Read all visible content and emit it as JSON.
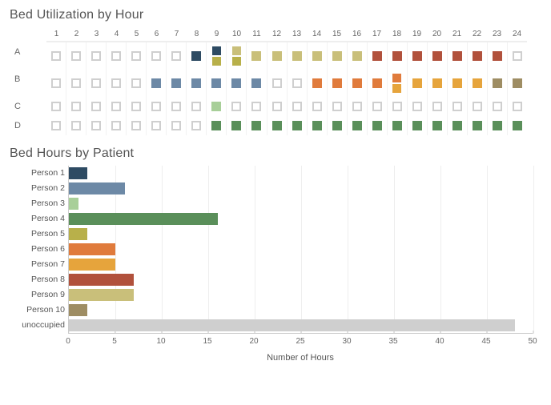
{
  "titles": {
    "heatmap": "Bed Utilization by Hour",
    "bars": "Bed Hours by Patient",
    "xlabel": "Number of Hours"
  },
  "colors": {
    "Person 1": "#2e4b63",
    "Person 2": "#6d89a6",
    "Person 3": "#a8cf99",
    "Person 4": "#5a8f5a",
    "Person 5": "#b8b04a",
    "Person 6": "#e07b3c",
    "Person 7": "#e6a43c",
    "Person 8": "#b1513c",
    "Person 9": "#c9bf7a",
    "Person 10": "#9e8d63",
    "unoccupied": "#cfcfcf"
  },
  "chart_data": [
    {
      "type": "heatmap",
      "title": "Bed Utilization by Hour",
      "x": [
        1,
        2,
        3,
        4,
        5,
        6,
        7,
        8,
        9,
        10,
        11,
        12,
        13,
        14,
        15,
        16,
        17,
        18,
        19,
        20,
        21,
        22,
        23,
        24
      ],
      "beds": [
        "A",
        "B",
        "C",
        "D"
      ],
      "occupancy": {
        "A": [
          "unoccupied",
          "unoccupied",
          "unoccupied",
          "unoccupied",
          "unoccupied",
          "unoccupied",
          "unoccupied",
          "Person 1",
          [
            "Person 1",
            "Person 5"
          ],
          [
            "Person 9",
            "Person 5"
          ],
          "Person 9",
          "Person 9",
          "Person 9",
          "Person 9",
          "Person 9",
          "Person 9",
          "Person 8",
          "Person 8",
          "Person 8",
          "Person 8",
          "Person 8",
          "Person 8",
          "Person 8",
          "unoccupied"
        ],
        "B": [
          "unoccupied",
          "unoccupied",
          "unoccupied",
          "unoccupied",
          "unoccupied",
          "Person 2",
          "Person 2",
          "Person 2",
          "Person 2",
          "Person 2",
          "Person 2",
          "unoccupied",
          "unoccupied",
          "Person 6",
          "Person 6",
          "Person 6",
          "Person 6",
          [
            "Person 6",
            "Person 7"
          ],
          "Person 7",
          "Person 7",
          "Person 7",
          "Person 7",
          "Person 10",
          "Person 10"
        ],
        "C": [
          "unoccupied",
          "unoccupied",
          "unoccupied",
          "unoccupied",
          "unoccupied",
          "unoccupied",
          "unoccupied",
          "unoccupied",
          "Person 3",
          "unoccupied",
          "unoccupied",
          "unoccupied",
          "unoccupied",
          "unoccupied",
          "unoccupied",
          "unoccupied",
          "unoccupied",
          "unoccupied",
          "unoccupied",
          "unoccupied",
          "unoccupied",
          "unoccupied",
          "unoccupied",
          "unoccupied"
        ],
        "D": [
          "unoccupied",
          "unoccupied",
          "unoccupied",
          "unoccupied",
          "unoccupied",
          "unoccupied",
          "unoccupied",
          "unoccupied",
          "Person 4",
          "Person 4",
          "Person 4",
          "Person 4",
          "Person 4",
          "Person 4",
          "Person 4",
          "Person 4",
          "Person 4",
          "Person 4",
          "Person 4",
          "Person 4",
          "Person 4",
          "Person 4",
          "Person 4",
          "Person 4"
        ]
      }
    },
    {
      "type": "bar",
      "title": "Bed Hours by Patient",
      "xlabel": "Number of Hours",
      "xlim": [
        0,
        50
      ],
      "xticks": [
        0,
        5,
        10,
        15,
        20,
        25,
        30,
        35,
        40,
        45,
        50
      ],
      "categories": [
        "Person 1",
        "Person 2",
        "Person 3",
        "Person 4",
        "Person 5",
        "Person 6",
        "Person 7",
        "Person 8",
        "Person 9",
        "Person 10",
        "unoccupied"
      ],
      "values": [
        2,
        6,
        1,
        16,
        2,
        5,
        5,
        7,
        7,
        2,
        48
      ]
    }
  ]
}
